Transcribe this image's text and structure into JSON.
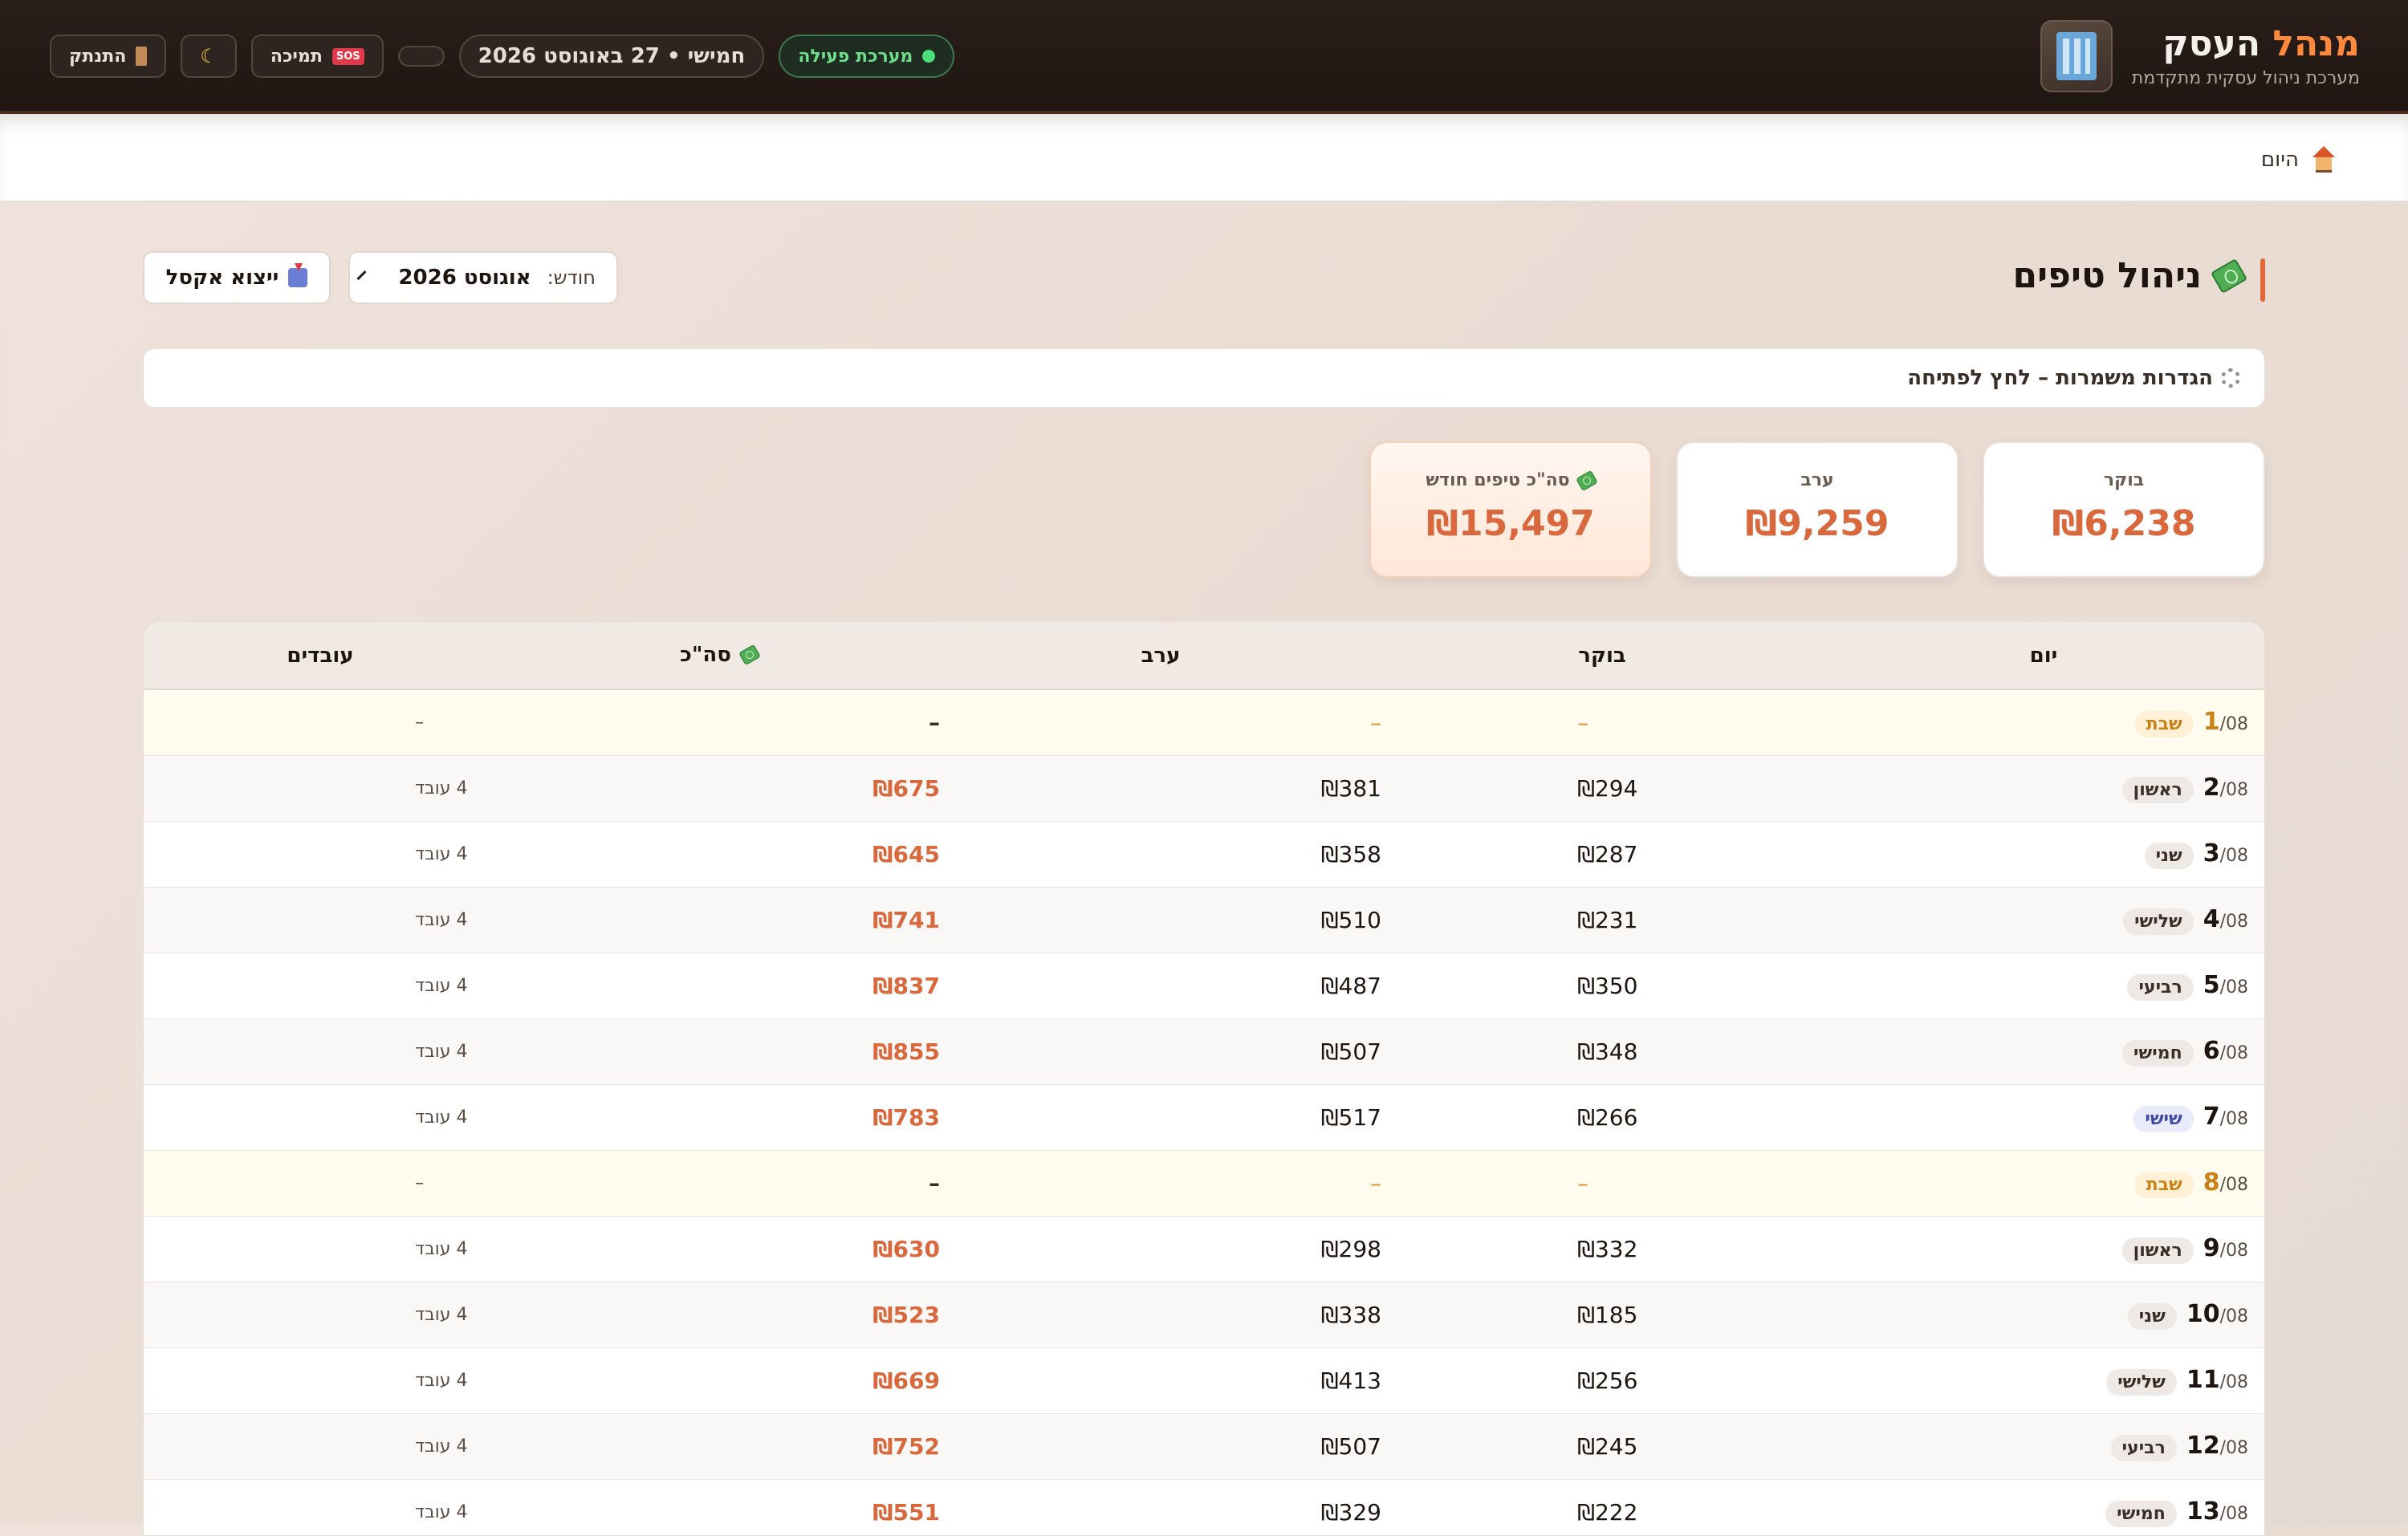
{
  "header": {
    "brand_title_1": "מנהל",
    "brand_title_2": "העסק",
    "brand_subtitle": "מערכת ניהול עסקית מתקדמת",
    "status_label": "מערכת פעילה",
    "date_label": "חמישי • 27 באוגוסט 2026",
    "support_label": "תמיכה",
    "logout_label": "התנתק"
  },
  "breadcrumb": {
    "home_label": "היום"
  },
  "page": {
    "title": "ניהול טיפים",
    "month_label": "חודש:",
    "month_value": "אוגוסט 2026",
    "export_label": "ייצוא אקסל",
    "settings_label": "הגדרות משמרות – לחץ לפתיחה"
  },
  "stats": {
    "morning_label": "בוקר",
    "morning_value": "₪6,238",
    "evening_label": "ערב",
    "evening_value": "₪9,259",
    "total_label": "סה\"כ טיפים חודש",
    "total_value": "₪15,497"
  },
  "table": {
    "headers": {
      "day": "יום",
      "morning": "בוקר",
      "evening": "ערב",
      "total": "סה\"כ",
      "workers": "עובדים"
    },
    "rows": [
      {
        "day": "1",
        "month": "/08",
        "dayname": "שבת",
        "type": "sat",
        "morning": "–",
        "evening": "–",
        "total": "–",
        "workers": "–"
      },
      {
        "day": "2",
        "month": "/08",
        "dayname": "ראשון",
        "type": "reg",
        "morning": "₪294",
        "evening": "₪381",
        "total": "₪675",
        "workers": "4 עובד"
      },
      {
        "day": "3",
        "month": "/08",
        "dayname": "שני",
        "type": "reg",
        "morning": "₪287",
        "evening": "₪358",
        "total": "₪645",
        "workers": "4 עובד"
      },
      {
        "day": "4",
        "month": "/08",
        "dayname": "שלישי",
        "type": "reg",
        "morning": "₪231",
        "evening": "₪510",
        "total": "₪741",
        "workers": "4 עובד"
      },
      {
        "day": "5",
        "month": "/08",
        "dayname": "רביעי",
        "type": "reg",
        "morning": "₪350",
        "evening": "₪487",
        "total": "₪837",
        "workers": "4 עובד"
      },
      {
        "day": "6",
        "month": "/08",
        "dayname": "חמישי",
        "type": "reg",
        "morning": "₪348",
        "evening": "₪507",
        "total": "₪855",
        "workers": "4 עובד"
      },
      {
        "day": "7",
        "month": "/08",
        "dayname": "שישי",
        "type": "fri",
        "morning": "₪266",
        "evening": "₪517",
        "total": "₪783",
        "workers": "4 עובד"
      },
      {
        "day": "8",
        "month": "/08",
        "dayname": "שבת",
        "type": "sat",
        "morning": "–",
        "evening": "–",
        "total": "–",
        "workers": "–"
      },
      {
        "day": "9",
        "month": "/08",
        "dayname": "ראשון",
        "type": "reg",
        "morning": "₪332",
        "evening": "₪298",
        "total": "₪630",
        "workers": "4 עובד"
      },
      {
        "day": "10",
        "month": "/08",
        "dayname": "שני",
        "type": "reg",
        "morning": "₪185",
        "evening": "₪338",
        "total": "₪523",
        "workers": "4 עובד"
      },
      {
        "day": "11",
        "month": "/08",
        "dayname": "שלישי",
        "type": "reg",
        "morning": "₪256",
        "evening": "₪413",
        "total": "₪669",
        "workers": "4 עובד"
      },
      {
        "day": "12",
        "month": "/08",
        "dayname": "רביעי",
        "type": "reg",
        "morning": "₪245",
        "evening": "₪507",
        "total": "₪752",
        "workers": "4 עובד"
      },
      {
        "day": "13",
        "month": "/08",
        "dayname": "חמישי",
        "type": "reg",
        "morning": "₪222",
        "evening": "₪329",
        "total": "₪551",
        "workers": "4 עובד"
      }
    ]
  }
}
